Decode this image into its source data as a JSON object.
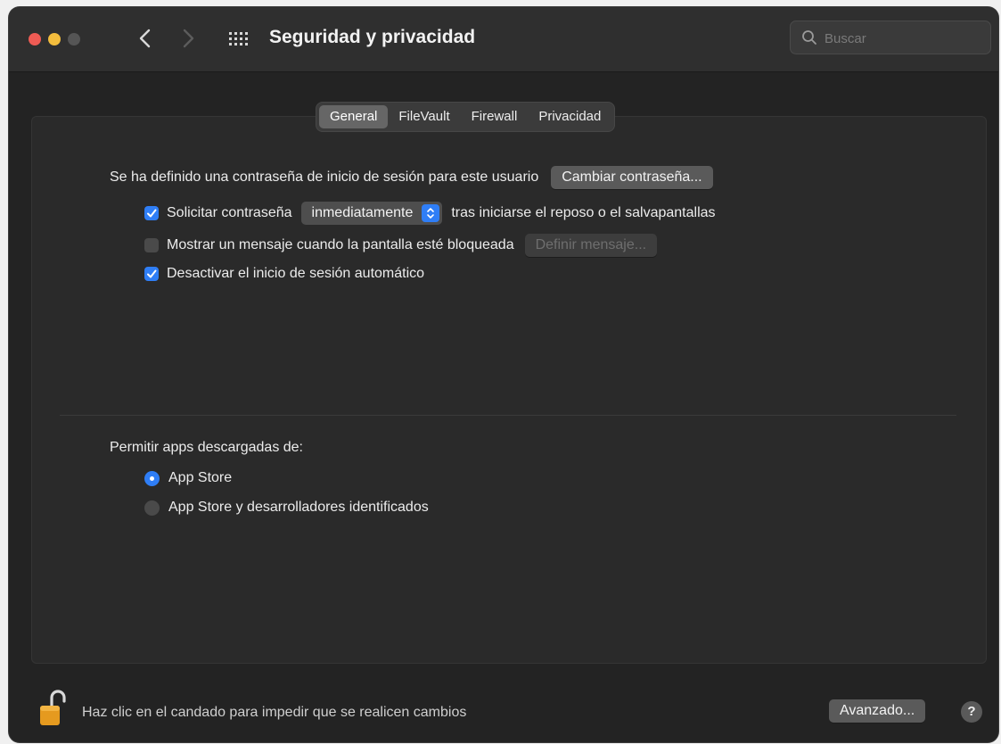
{
  "window": {
    "title": "Seguridad y privacidad",
    "search_placeholder": "Buscar"
  },
  "tabs": [
    {
      "label": "General",
      "active": true
    },
    {
      "label": "FileVault",
      "active": false
    },
    {
      "label": "Firewall",
      "active": false
    },
    {
      "label": "Privacidad",
      "active": false
    }
  ],
  "general": {
    "password_text": "Se ha definido una contraseña de inicio de sesión para este usuario",
    "change_password_button": "Cambiar contraseña...",
    "require_password": {
      "checked": true,
      "label": "Solicitar contraseña",
      "popup_value": "inmediatamente",
      "suffix": "tras iniciarse el reposo o el salvapantallas"
    },
    "show_message": {
      "checked": false,
      "label": "Mostrar un mensaje cuando la pantalla esté bloqueada",
      "button": "Definir mensaje..."
    },
    "disable_autologin": {
      "checked": true,
      "label": "Desactivar el inicio de sesión automático"
    },
    "allow_apps_title": "Permitir apps descargadas de:",
    "allow_apps_options": [
      {
        "label": "App Store",
        "selected": true
      },
      {
        "label": "App Store y desarrolladores identificados",
        "selected": false
      }
    ]
  },
  "footer": {
    "lock_text": "Haz clic en el candado para impedir que se realicen cambios",
    "advanced_button": "Avanzado...",
    "help_label": "?"
  },
  "colors": {
    "accent": "#2f7ef6",
    "window_bg": "#232323",
    "titlebar_bg": "#2f2f2f"
  }
}
